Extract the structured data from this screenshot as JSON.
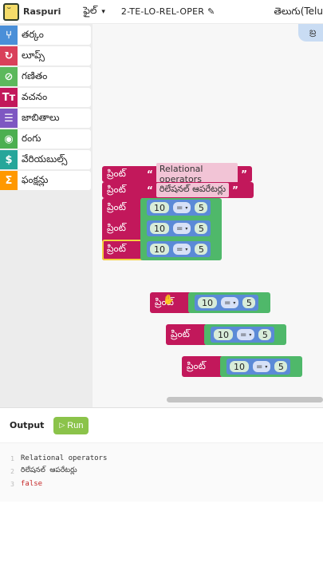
{
  "header": {
    "brand": "Raspuri",
    "file_menu": "ఫైల్",
    "file_caret": "▾",
    "project_name": "2-TE-LO-REL-OPER",
    "edit_icon": "✎",
    "language": "తెలుగు(Telu"
  },
  "toolbox": {
    "categories": [
      {
        "label": "తర్కం",
        "icon": "⑂",
        "color": "#4a8fd8"
      },
      {
        "label": "లూప్స్",
        "icon": "↻",
        "color": "#d9405a"
      },
      {
        "label": "గణితం",
        "icon": "⊘",
        "color": "#5cb85c"
      },
      {
        "label": "వచనం",
        "icon": "Tт",
        "color": "#c2185b"
      },
      {
        "label": "జాబితాలు",
        "icon": "☰",
        "color": "#7e57c2"
      },
      {
        "label": "రంగు",
        "icon": "◉",
        "color": "#4caf50"
      },
      {
        "label": "వేరియబుల్స్",
        "icon": "$",
        "color": "#26a69a"
      },
      {
        "label": "ఫంక్షన్లు",
        "icon": "Σ",
        "color": "#ff9800"
      }
    ]
  },
  "flyout_tab": "బ్ర",
  "blocks": {
    "print_label": "ప్రింట్",
    "open_quote": "“",
    "close_quote": "”",
    "strings": [
      "Relational operators",
      "రిలేషనల్ ఆపరేటర్లు"
    ],
    "compare": [
      {
        "left": "10",
        "op": "=",
        "right": "5"
      },
      {
        "left": "10",
        "op": "=",
        "right": "5"
      },
      {
        "left": "10",
        "op": "=",
        "right": "5"
      },
      {
        "left": "10",
        "op": "=",
        "right": "5"
      },
      {
        "left": "10",
        "op": "=",
        "right": "5"
      },
      {
        "left": "10",
        "op": "=",
        "right": "5"
      }
    ],
    "op_caret": "▾"
  },
  "output": {
    "title": "Output",
    "run_label": "Run",
    "run_icon": "▷",
    "lines": [
      {
        "n": "1",
        "text": "Relational operators"
      },
      {
        "n": "2",
        "text": "రిలేషనల్ ఆపరేటర్లు"
      },
      {
        "n": "3",
        "text": "false"
      }
    ]
  }
}
